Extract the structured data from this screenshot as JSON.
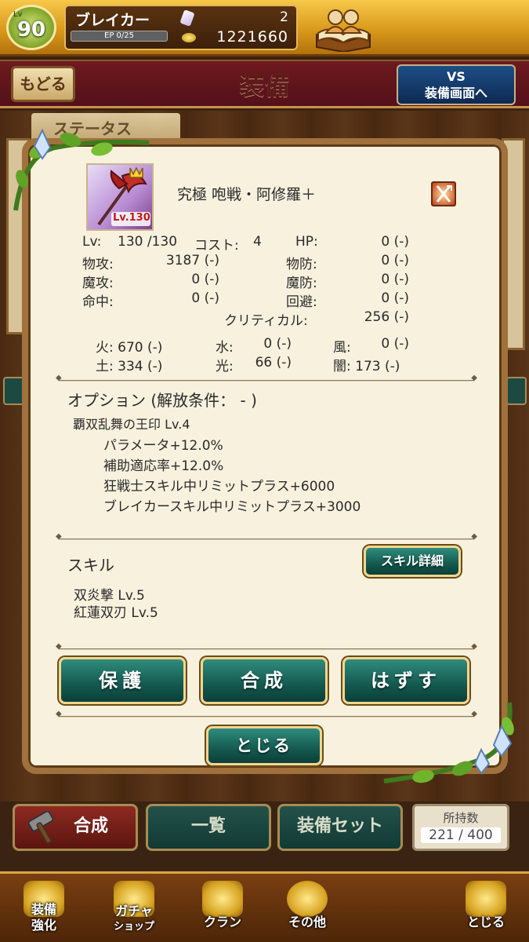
{
  "player": {
    "level_caption": "Lv",
    "level": "90",
    "name": "ブレイカー",
    "ep": "EP 0/25",
    "gems": "2",
    "gold": "1221660"
  },
  "header": {
    "back_label": "もどる",
    "title": "装備",
    "vs_line1": "VS",
    "vs_line2": "装備画面へ",
    "status_tab": "ステータス"
  },
  "item": {
    "name": "究極 咆戦・阿修羅＋",
    "img_level": "Lv.130",
    "stats": {
      "lv_label": "Lv:",
      "lv_value": "130 /130",
      "cost_label": "コスト:",
      "cost_value": "4",
      "hp_label": "HP:",
      "hp_value": "0 (-)",
      "patk_label": "物攻:",
      "patk_value": "3187 (-)",
      "pdef_label": "物防:",
      "pdef_value": "0 (-)",
      "matk_label": "魔攻:",
      "matk_value": "0 (-)",
      "mdef_label": "魔防:",
      "mdef_value": "0 (-)",
      "hit_label": "命中:",
      "hit_value": "0 (-)",
      "eva_label": "回避:",
      "eva_value": "0 (-)",
      "crit_label": "クリティカル:",
      "crit_value": "256 (-)"
    },
    "elements": {
      "fire": "火: 670 (-)",
      "water_label": "水:",
      "water_value": "0 (-)",
      "wind_label": "風:",
      "wind_value": "0 (-)",
      "earth": "土: 334 (-)",
      "light_label": "光:",
      "light_value": "66 (-)",
      "dark": "闇: 173 (-)"
    }
  },
  "option": {
    "title": "オプション (解放条件： - )",
    "name": "覇双乱舞の王印 Lv.4",
    "lines": [
      "パラメータ+12.0%",
      "補助適応率+12.0%",
      "狂戦士スキル中リミットプラス+6000",
      "ブレイカースキル中リミットプラス+3000"
    ]
  },
  "skill": {
    "title": "スキル",
    "detail_button": "スキル詳細",
    "list": [
      "双炎撃  Lv.5",
      "紅蓮双刃  Lv.5"
    ]
  },
  "actions": {
    "protect": "保護",
    "combine": "合成",
    "remove": "はずす",
    "close": "とじる"
  },
  "tabs": {
    "combine": "合成",
    "list": "一覧",
    "equip_set": "装備セット",
    "owned_label": "所持数",
    "owned_value": "221 / 400"
  },
  "nav": {
    "enhance_1": "装備",
    "enhance_2": "強化",
    "gacha_1": "ガチャ",
    "gacha_2": "ショップ",
    "clan": "クラン",
    "other": "その他",
    "close": "とじる"
  },
  "colors": {
    "accent_green": "#14594f",
    "frame_gold": "#f0d690",
    "header_red": "#6e1a1e",
    "parchment": "#f8f1de"
  }
}
